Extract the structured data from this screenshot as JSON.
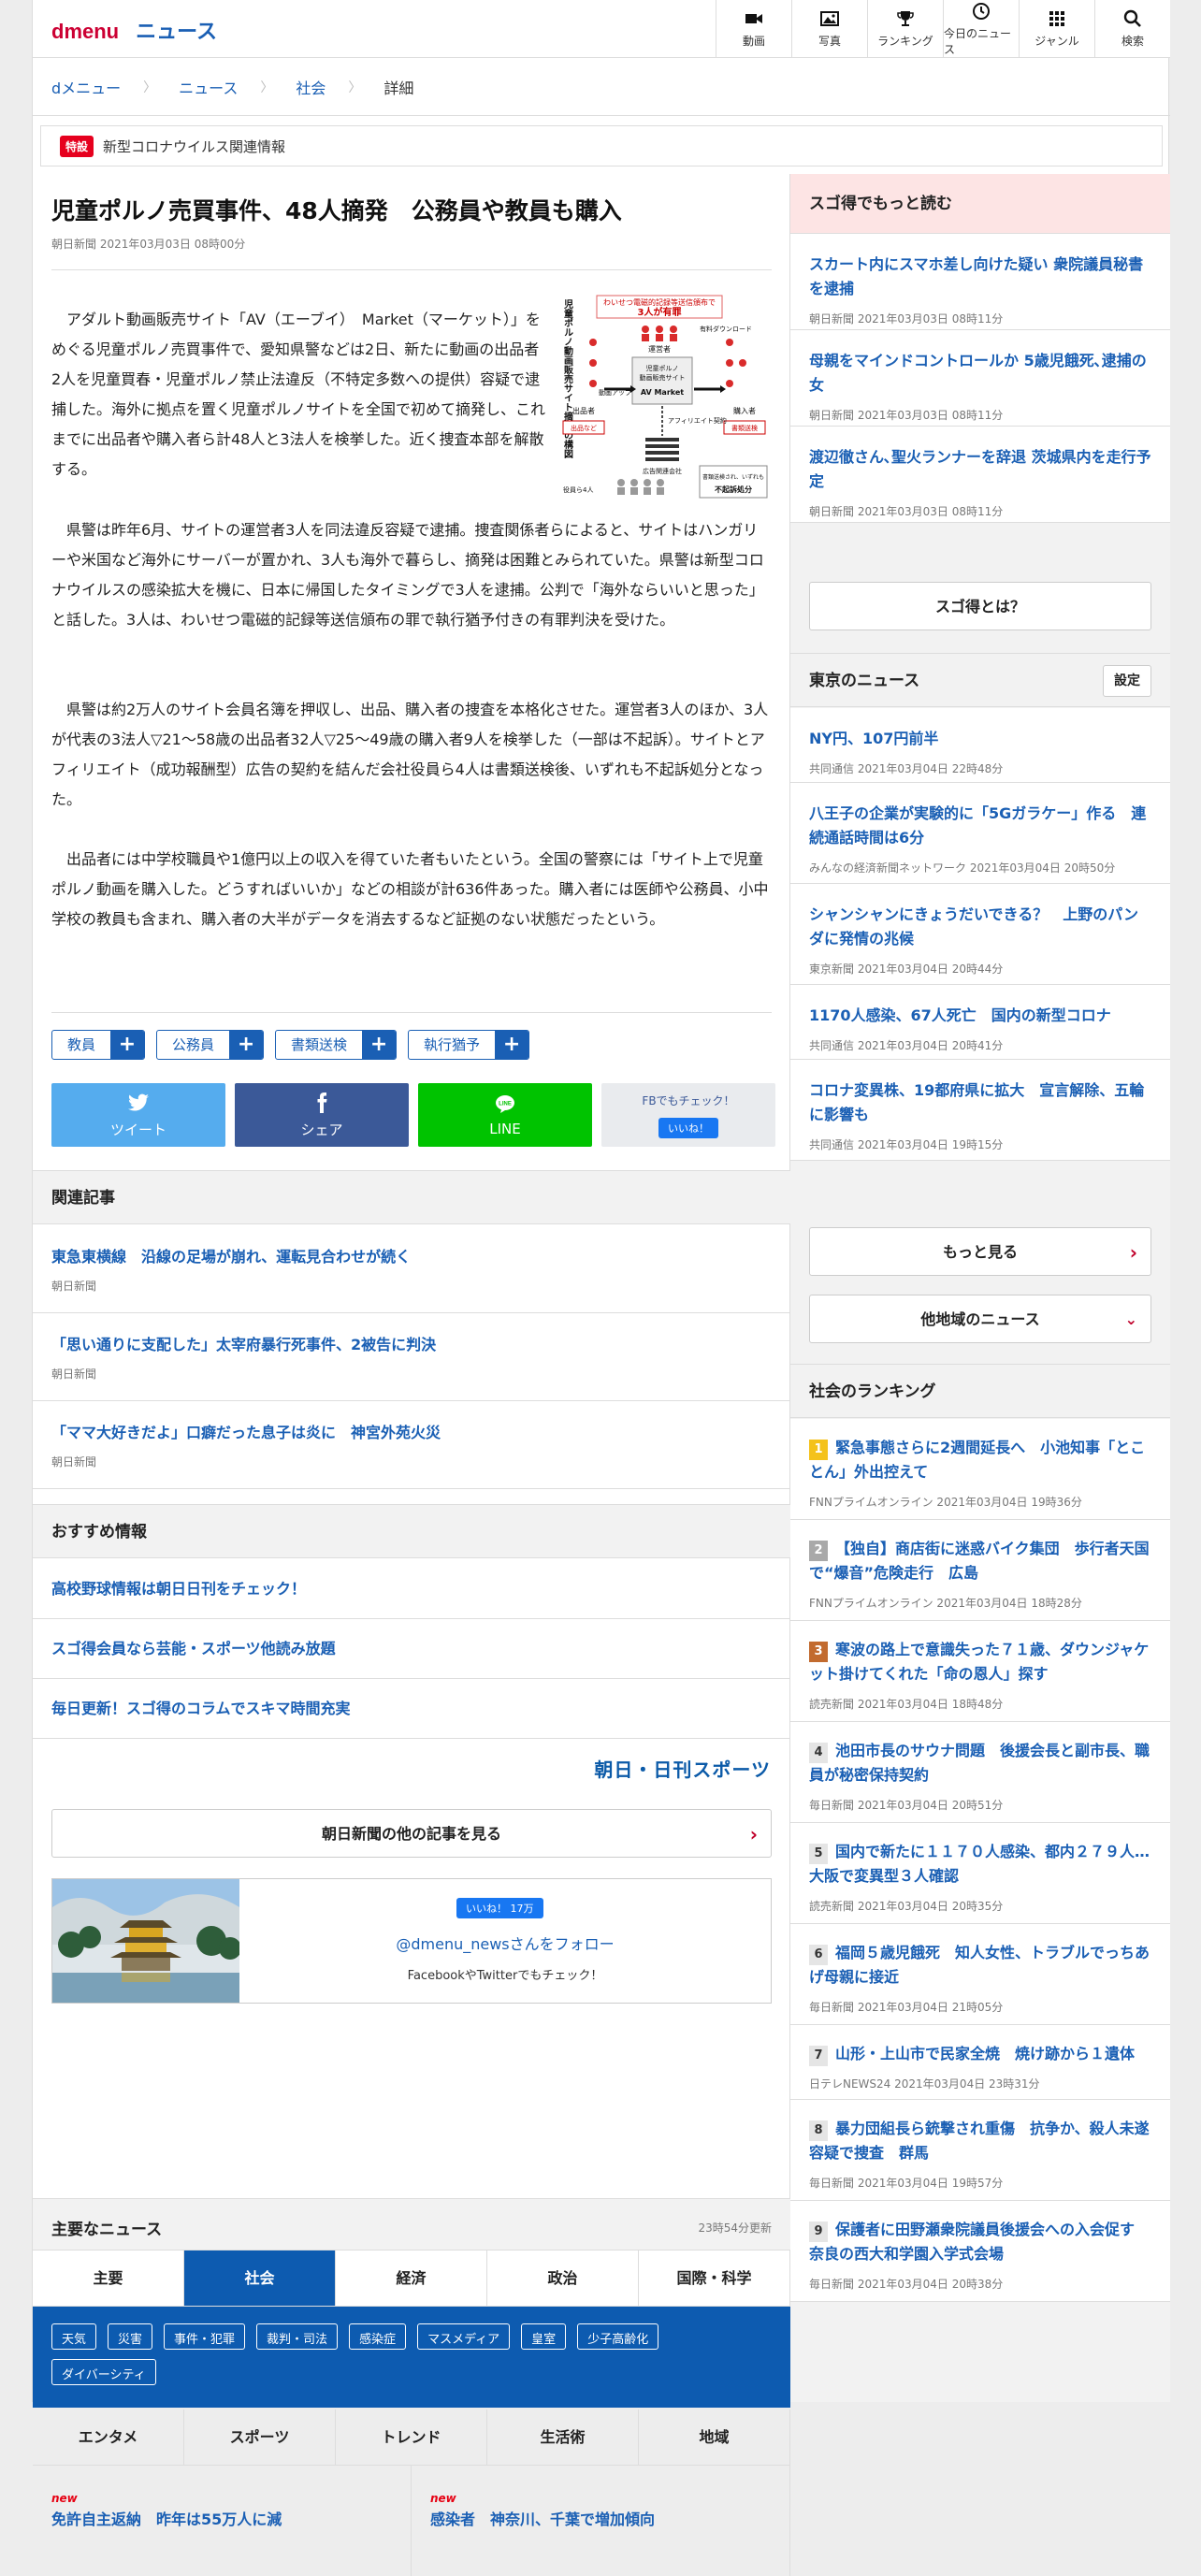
{
  "header": {
    "logo": "dmenu",
    "section": "ニュース",
    "nav": [
      {
        "label": "動画",
        "icon": "video-icon"
      },
      {
        "label": "写真",
        "icon": "photo-icon"
      },
      {
        "label": "ランキング",
        "icon": "trophy-icon"
      },
      {
        "label": "今日のニュース",
        "icon": "clock-icon"
      },
      {
        "label": "ジャンル",
        "icon": "grid-icon"
      },
      {
        "label": "検索",
        "icon": "search-icon"
      }
    ]
  },
  "breadcrumb": [
    "dメニュー",
    "ニュース",
    "社会",
    "詳細"
  ],
  "special": {
    "tag": "特設",
    "text": "新型コロナウイルス関連情報"
  },
  "article": {
    "title": "児童ポルノ売買事件、48人摘発　公務員や教員も購入",
    "meta": "朝日新聞 2021年03月03日 08時00分",
    "paragraphs": [
      "アダルト動画販売サイト「AV（エーブイ）　Market（マーケット）」をめぐる児童ポルノ売買事件で、愛知県警などは2日、新たに動画の出品者2人を児童買春・児童ポルノ禁止法違反（不特定多数への提供）容疑で逮捕した。海外に拠点を置く児童ポルノサイトを全国で初めて摘発し、これまでに出品者や購入者ら計48人と3法人を検挙した。近く捜査本部を解散する。",
      "県警は昨年6月、サイトの運営者3人を同法違反容疑で逮捕。捜査関係者らによると、サイトはハンガリーや米国など海外にサーバーが置かれ、3人も海外で暮らし、摘発は困難とみられていた。県警は新型コロナウイルスの感染拡大を機に、日本に帰国したタイミングで3人を逮捕。公判で「海外ならいいと思った」と話した。3人は、わいせつ電磁的記録等送信頒布の罪で執行猶予付きの有罪判決を受けた。",
      "県警は約2万人のサイト会員名簿を押収し、出品、購入者の捜査を本格化させた。運営者3人のほか、3人が代表の3法人▽21〜58歳の出品者32人▽25〜49歳の購入者9人を検挙した（一部は不起訴）。サイトとアフィリエイト（成功報酬型）広告の契約を結んだ会社役員ら4人は書類送検後、いずれも不起訴処分となった。",
      "出品者には中学校職員や1億円以上の収入を得ていた者もいたという。全国の警察には「サイト上で児童ポルノ動画を購入した。どうすればいいか」などの相談が計636件あった。購入者には医師や公務員、小中学校の教員も含まれ、購入者の大半がデータを消去するなど証拠のない状態だったという。"
    ],
    "figure": {
      "vertical_title": "児童ポルノ動画販売サイト摘発の構図",
      "headline1": "わいせつ電磁的記録等送信頒布で",
      "headline2": "3人が有罪",
      "operators": "運営者",
      "seller": "出品者",
      "buyer": "購入者",
      "upload": "動画アップロード",
      "download": "有料ダウンロード",
      "site_line1": "児童ポルノ",
      "site_line2": "動画販売サイト",
      "site_name": "アダルト動画販売サイト",
      "site_brand": "AV Market",
      "affiliate": "アフィリエイト契約",
      "ad": "広告関連会社",
      "officers": "役員ら4人",
      "sent": "書類送検され、いずれも",
      "nonpros": "不起訴処分",
      "tag_seller": "出品など",
      "tag_buyer": "書類送検"
    },
    "tags": [
      "教員",
      "公務員",
      "書類送検",
      "執行猶予"
    ],
    "share": {
      "tweet": "ツイート",
      "share": "シェア",
      "line": "LINE",
      "fb_check": "FBでもチェック！",
      "like": "いいね！"
    }
  },
  "related": {
    "title": "関連記事",
    "items": [
      {
        "title": "東急東横線　沿線の足場が崩れ、運転見合わせが続く",
        "source": "朝日新聞"
      },
      {
        "title": "「思い通りに支配した」太宰府暴行死事件、2被告に判決",
        "source": "朝日新聞"
      },
      {
        "title": "「ママ大好きだよ」口癖だった息子は炎に　神宮外苑火災",
        "source": "朝日新聞"
      }
    ]
  },
  "recommend": {
    "title": "おすすめ情報",
    "items": [
      "高校野球情報は朝日日刊をチェック！",
      "スゴ得会員なら芸能・スポーツ他読み放題",
      "毎日更新！スゴ得のコラムでスキマ時間充実"
    ]
  },
  "publisher": {
    "logo": "朝日・日刊スポーツ",
    "more": "朝日新聞の他の記事を見る"
  },
  "follow": {
    "like": "いいね！ 17万",
    "account": "@dmenu_newsさんをフォロー",
    "sub": "FacebookやTwitterでもチェック！"
  },
  "major": {
    "title": "主要なニュース",
    "updated": "23時54分更新",
    "tabs1": [
      "主要",
      "社会",
      "経済",
      "政治",
      "国際・科学"
    ],
    "subtags": [
      "天気",
      "災害",
      "事件・犯罪",
      "裁判・司法",
      "感染症",
      "マスメディア",
      "皇室",
      "少子高齢化",
      "ダイバーシティ"
    ],
    "tabs2": [
      "エンタメ",
      "スポーツ",
      "トレンド",
      "生活術",
      "地域"
    ],
    "news": [
      {
        "badge": "new",
        "title": "免許自主返納　昨年は55万人に減"
      },
      {
        "badge": "new",
        "title": "感染者　神奈川、千葉で増加傾向"
      }
    ]
  },
  "side": {
    "sugo_title": "スゴ得でもっと読む",
    "sugo": [
      {
        "title": "スカート内にスマホ差し向けた疑い 衆院議員秘書を逮捕",
        "meta": "朝日新聞 2021年03月03日 08時11分"
      },
      {
        "title": "母親をマインドコントロールか 5歳児餓死､逮捕の女",
        "meta": "朝日新聞 2021年03月03日 08時11分"
      },
      {
        "title": "渡辺徹さん､聖火ランナーを辞退 茨城県内を走行予定",
        "meta": "朝日新聞 2021年03月03日 08時11分"
      }
    ],
    "sugo_about": "スゴ得とは？",
    "tokyo_title": "東京のニュース",
    "settings": "設定",
    "tokyo": [
      {
        "title": "NY円、107円前半",
        "meta": "共同通信 2021年03月04日 22時48分"
      },
      {
        "title": "八王子の企業が実験的に「5Gガラケー」作る　連続通話時間は6分",
        "meta": "みんなの経済新聞ネットワーク 2021年03月04日 20時50分"
      },
      {
        "title": "シャンシャンにきょうだいできる？　上野のパンダに発情の兆候",
        "meta": "東京新聞 2021年03月04日 20時44分"
      },
      {
        "title": "1170人感染、67人死亡　国内の新型コロナ",
        "meta": "共同通信 2021年03月04日 20時41分"
      },
      {
        "title": "コロナ変異株、19都府県に拡大　宣言解除、五輪に影響も",
        "meta": "共同通信 2021年03月04日 19時15分"
      }
    ],
    "more": "もっと見る",
    "other_region": "他地域のニュース",
    "ranking_title": "社会のランキング",
    "ranking": [
      {
        "rank": "1",
        "title": "緊急事態さらに2週間延長へ　小池知事「とことん」外出控えて",
        "meta": "FNNプライムオンライン 2021年03月04日 19時36分"
      },
      {
        "rank": "2",
        "title": "【独自】商店街に迷惑バイク集団　歩行者天国で“爆音”危険走行　広島",
        "meta": "FNNプライムオンライン 2021年03月04日 18時28分"
      },
      {
        "rank": "3",
        "title": "寒波の路上で意識失った７１歳、ダウンジャケット掛けてくれた「命の恩人」探す",
        "meta": "読売新聞 2021年03月04日 18時48分"
      },
      {
        "rank": "4",
        "title": "池田市長のサウナ問題　後援会長と副市長、職員が秘密保持契約",
        "meta": "毎日新聞 2021年03月04日 20時51分"
      },
      {
        "rank": "5",
        "title": "国内で新たに１１７０人感染、都内２７９人…大阪で変異型３人確認",
        "meta": "読売新聞 2021年03月04日 20時35分"
      },
      {
        "rank": "6",
        "title": "福岡５歳児餓死　知人女性、トラブルでっちあげ母親に接近",
        "meta": "毎日新聞 2021年03月04日 21時05分"
      },
      {
        "rank": "7",
        "title": "山形・上山市で民家全焼　焼け跡から１遺体",
        "meta": "日テレNEWS24 2021年03月04日 23時31分"
      },
      {
        "rank": "8",
        "title": "暴力団組長ら銃撃され重傷　抗争か、殺人未遂容疑で捜査　群馬",
        "meta": "毎日新聞 2021年03月04日 19時57分"
      },
      {
        "rank": "9",
        "title": "保護者に田野瀬衆院議員後援会への入会促す　奈良の西大和学園入学式会場",
        "meta": "毎日新聞 2021年03月04日 20時38分"
      }
    ]
  }
}
